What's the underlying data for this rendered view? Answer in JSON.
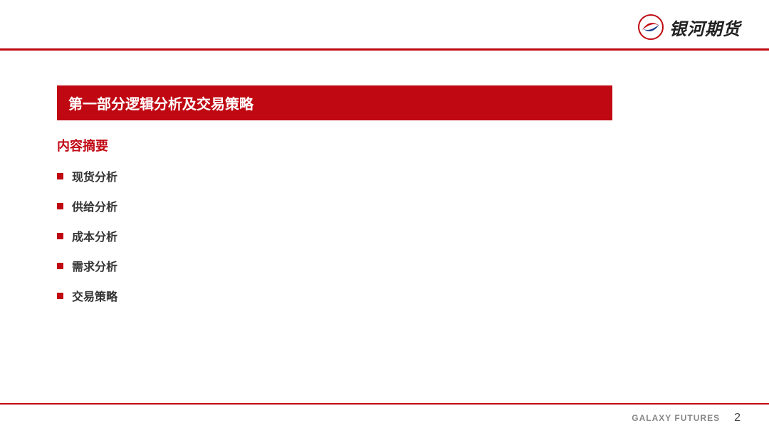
{
  "brand": {
    "name_cn": "银河期货",
    "name_en": "GALAXY FUTURES"
  },
  "section_title": "第一部分逻辑分析及交易策略",
  "summary_heading": "内容摘要",
  "bullets": {
    "b0": "现货分析",
    "b1": "供给分析",
    "b2": "成本分析",
    "b3": "需求分析",
    "b4": "交易策略"
  },
  "page_number": "2",
  "colors": {
    "brand_red": "#c00812"
  }
}
